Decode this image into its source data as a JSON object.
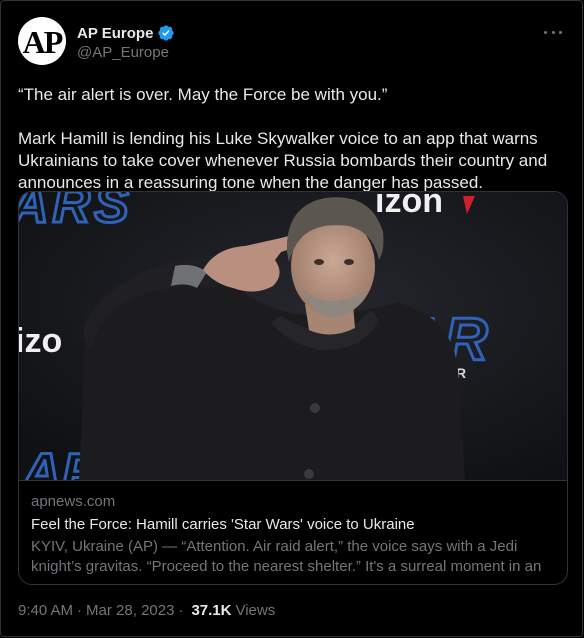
{
  "author": {
    "avatar_text": "AP",
    "name": "AP Europe",
    "handle": "@AP_Europe",
    "verified_color": "#1d9bf0"
  },
  "more_icon": "more-horizontal-icon",
  "tweet": {
    "paragraph1": "“The air alert is over. May the Force be with you.”",
    "paragraph2": "Mark Hamill is lending his Luke Skywalker voice to an app that warns Ukrainians to take cover whenever Russia bombards their country and announces in a reassuring tone when the danger has passed."
  },
  "link_card": {
    "photo_subject": "Mark Hamill saluting in front of a Star Wars backdrop",
    "backdrop_texts": [
      "ARS",
      "izon",
      "izo",
      "AR",
      "LKER",
      "AR"
    ],
    "domain": "apnews.com",
    "title": "Feel the Force: Hamill carries 'Star Wars' voice to Ukraine",
    "description": "KYIV, Ukraine (AP) — “Attention. Air raid alert,” the voice says with a Jedi knight’s gravitas. “Proceed to the nearest shelter.” It's a surreal moment in an ..."
  },
  "meta": {
    "time": "9:40 AM",
    "separator": "·",
    "date": "Mar 28, 2023",
    "views_count": "37.1K",
    "views_label": "Views"
  },
  "colors": {
    "background": "#000000",
    "text": "#e7e9ea",
    "muted": "#71767b",
    "border": "#2f3336",
    "backdrop_blue": "#2f63b8",
    "backdrop_red": "#d0202e"
  }
}
